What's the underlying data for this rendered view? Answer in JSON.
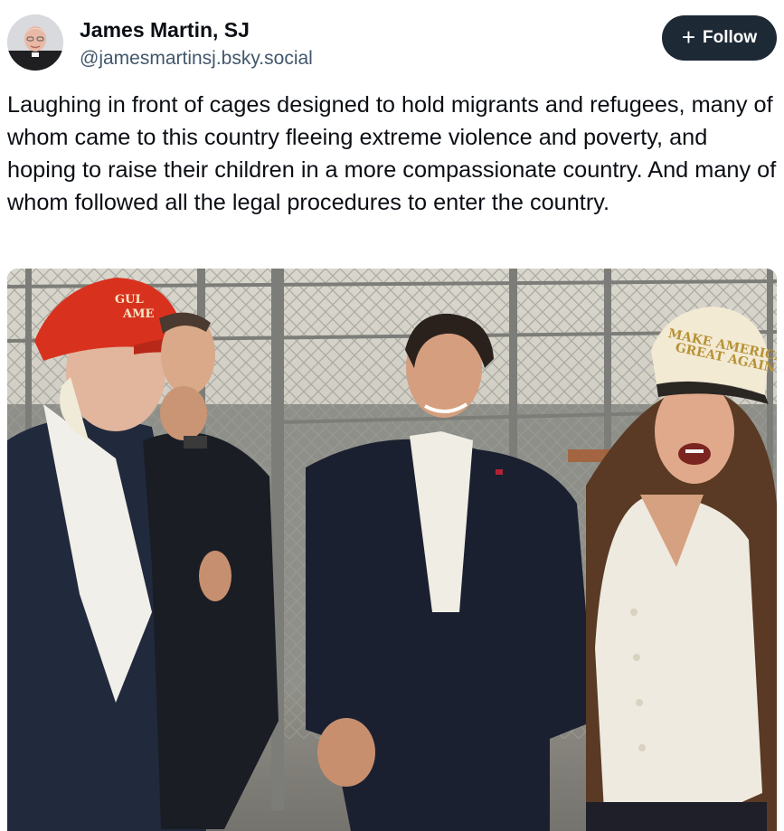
{
  "author": {
    "display_name": "James Martin, SJ",
    "handle": "@jamesmartinsj.bsky.social",
    "avatar_icon": "profile-photo"
  },
  "follow_button": {
    "icon": "plus-icon",
    "label": "Follow"
  },
  "post": {
    "text": "Laughing in front of cages designed to hold migrants and refugees, many of whom came to this country fleeing extreme violence and poverty, and hoping to raise their children in a more compassionate country. And many of whom followed all the legal procedures to enter the country."
  },
  "photo": {
    "red_hat_text_line1": "GUL",
    "red_hat_text_line2": "AME",
    "white_hat_text_line1": "MAKE AMERICA",
    "white_hat_text_line2": "GREAT AGAIN"
  },
  "colors": {
    "follow_bg": "#1e2936",
    "handle": "#42576c",
    "text": "#0b0f14"
  }
}
